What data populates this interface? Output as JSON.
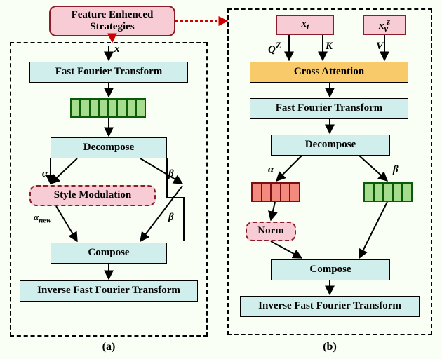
{
  "title": "Feature Enhenced Strategies",
  "left": {
    "input": "x",
    "fft": "Fast Fourier Transform",
    "decompose": "Decompose",
    "alpha": "α",
    "beta": "β",
    "style_mod": "Style Modulation",
    "alpha_new": "α_new",
    "compose": "Compose",
    "ifft": "Inverse Fast Fourier Transform",
    "caption": "(a)"
  },
  "right": {
    "xt": "x_t",
    "xv": "x_v^z",
    "Q": "Q^Z",
    "K": "K",
    "V": "V",
    "cross_attn": "Cross Attention",
    "fft": "Fast Fourier Transform",
    "decompose": "Decompose",
    "alpha": "α",
    "beta": "β",
    "norm": "Norm",
    "compose": "Compose",
    "ifft": "Inverse Fast Fourier Transform",
    "caption": "(b)"
  }
}
